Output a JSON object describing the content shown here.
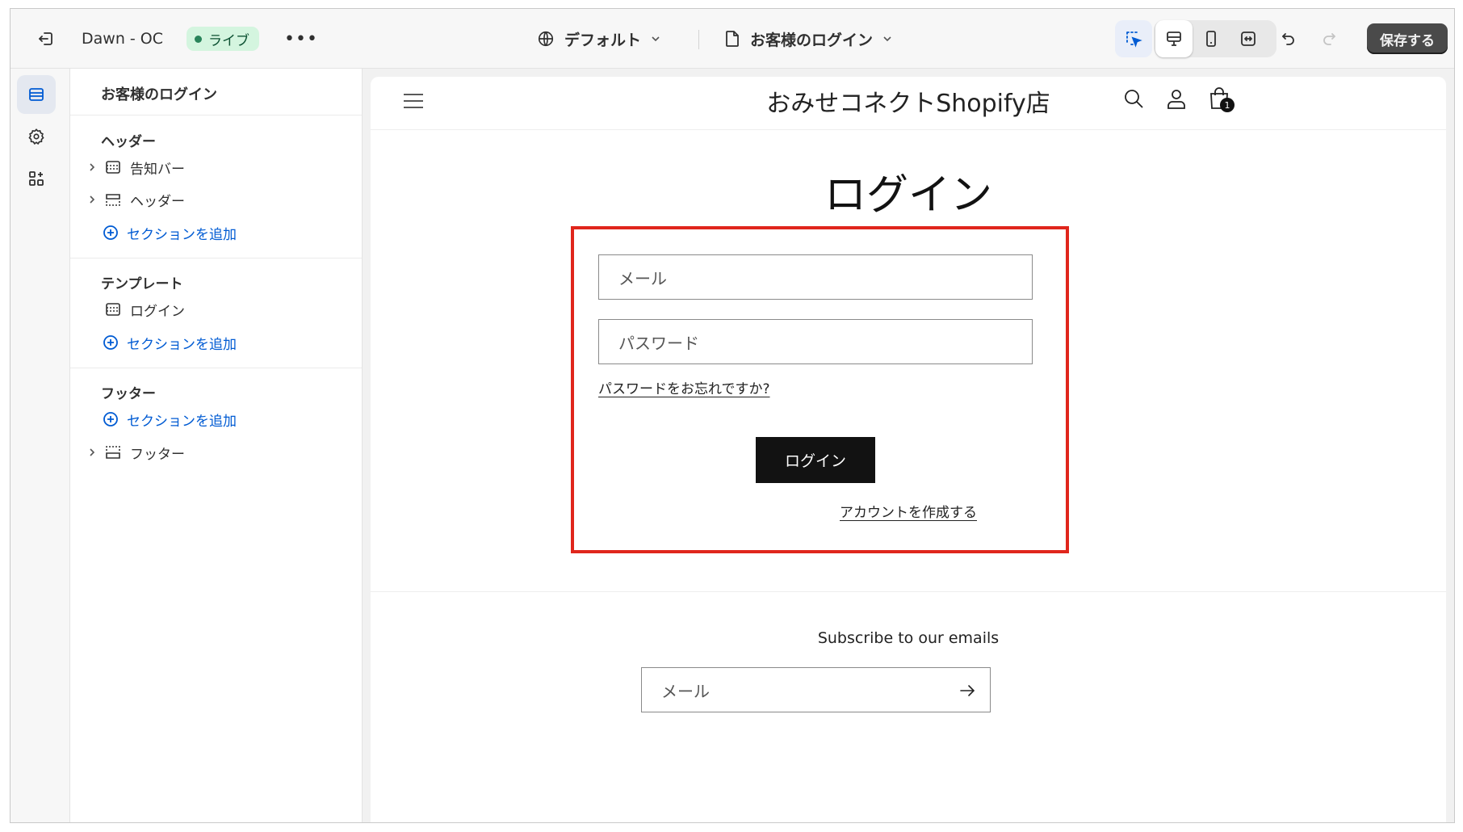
{
  "topbar": {
    "theme_name": "Dawn - OC",
    "live_badge": "ライブ",
    "more": "•••",
    "template_selector": "デフォルト",
    "page_selector": "お客様のログイン",
    "save_label": "保存する"
  },
  "sidebar": {
    "title": "お客様のログイン",
    "groups": [
      {
        "label": "ヘッダー",
        "items": [
          "告知バー",
          "ヘッダー"
        ],
        "add_label": "セクションを追加"
      },
      {
        "label": "テンプレート",
        "items": [
          "ログイン"
        ],
        "add_label": "セクションを追加"
      },
      {
        "label": "フッター",
        "add_label": "セクションを追加",
        "items": [
          "フッター"
        ]
      }
    ]
  },
  "store": {
    "name": "おみせコネクトShopify店",
    "cart_count": "1",
    "login_heading": "ログイン",
    "email_placeholder": "メール",
    "password_placeholder": "パスワード",
    "forgot_link": "パスワードをお忘れですか?",
    "login_button": "ログイン",
    "create_account": "アカウントを作成する",
    "subscribe_title": "Subscribe to our emails",
    "subscribe_placeholder": "メール"
  },
  "colors": {
    "accent_blue": "#005bd3",
    "highlight_red": "#e0261c",
    "live_green": "#29845a",
    "button_dark": "#121212"
  }
}
